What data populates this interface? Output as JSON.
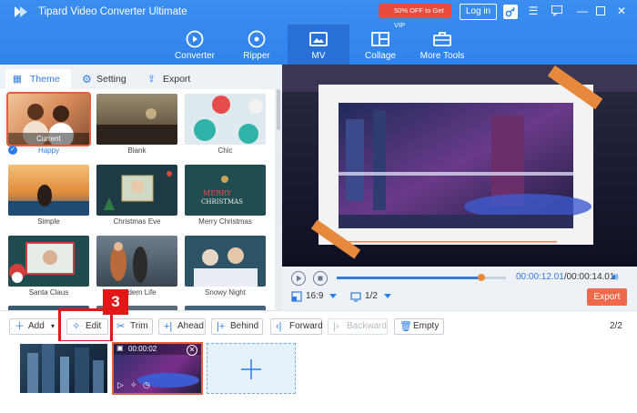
{
  "app": {
    "title": "Tipard Video Converter Ultimate",
    "promo": "50% OFF to Get VIP",
    "login": "Log in"
  },
  "nav": {
    "items": [
      {
        "label": "Converter",
        "icon": "converter-icon"
      },
      {
        "label": "Ripper",
        "icon": "ripper-icon"
      },
      {
        "label": "MV",
        "icon": "mv-icon",
        "active": true
      },
      {
        "label": "Collage",
        "icon": "collage-icon"
      },
      {
        "label": "More Tools",
        "icon": "toolbox-icon"
      }
    ]
  },
  "tabs": [
    {
      "label": "Theme",
      "active": true
    },
    {
      "label": "Setting"
    },
    {
      "label": "Export"
    }
  ],
  "themes": [
    {
      "label": "Happy",
      "badge": "Current",
      "selected": true
    },
    {
      "label": "Blank"
    },
    {
      "label": "Chic"
    },
    {
      "label": "Simple"
    },
    {
      "label": "Christmas Eve"
    },
    {
      "label": "Merry Christmas"
    },
    {
      "label": "Santa Claus"
    },
    {
      "label": "Modern Life"
    },
    {
      "label": "Snowy Night"
    }
  ],
  "preview": {
    "time_current": "00:00:12.01",
    "time_total": "/00:00:14.01",
    "progress": 0.857,
    "aspect": "16:9",
    "page": "1/2",
    "export": "Export"
  },
  "toolbar": {
    "add": "Add",
    "edit": "Edit",
    "trim": "Trim",
    "ahead": "Ahead",
    "behind": "Behind",
    "forward": "Forward",
    "backward": "Backward",
    "empty": "Empty",
    "count": "2/2"
  },
  "annotation": {
    "step": "3"
  },
  "clips": [
    {
      "duration": ""
    },
    {
      "duration": "00:00:02",
      "selected": true
    }
  ],
  "colors": {
    "brand": "#2f83ec",
    "accent": "#e35f3e",
    "highlight": "#e21818"
  }
}
